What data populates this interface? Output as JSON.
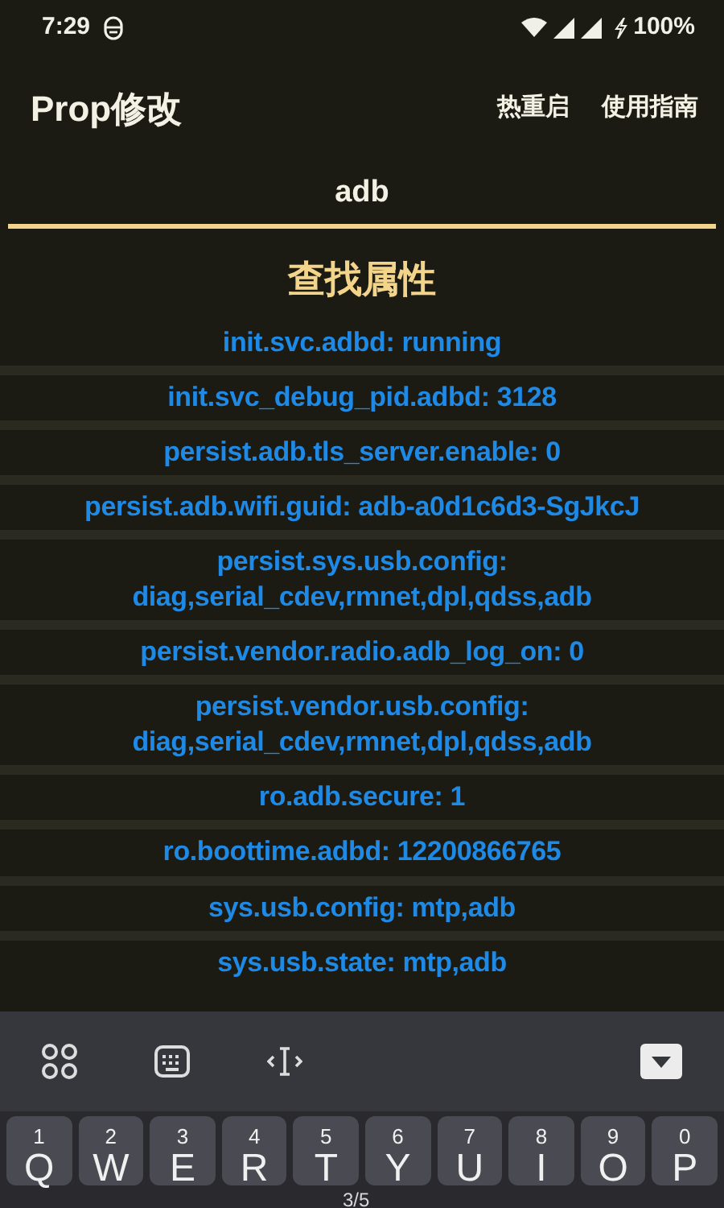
{
  "status_bar": {
    "time": "7:29",
    "battery": "100%"
  },
  "app_bar": {
    "title": "Prop修改",
    "actions": [
      "热重启",
      "使用指南"
    ]
  },
  "search": {
    "value": "adb"
  },
  "heading": "查找属性",
  "results": [
    "init.svc.adbd: running",
    "init.svc_debug_pid.adbd: 3128",
    "persist.adb.tls_server.enable: 0",
    "persist.adb.wifi.guid: adb-a0d1c6d3-SgJkcJ",
    "persist.sys.usb.config: diag,serial_cdev,rmnet,dpl,qdss,adb",
    "persist.vendor.radio.adb_log_on: 0",
    "persist.vendor.usb.config: diag,serial_cdev,rmnet,dpl,qdss,adb",
    "ro.adb.secure: 1",
    "ro.boottime.adbd: 12200866765",
    "sys.usb.config: mtp,adb",
    "sys.usb.state: mtp,adb"
  ],
  "keyboard": {
    "keys": [
      {
        "hint": "1",
        "label": "Q"
      },
      {
        "hint": "2",
        "label": "W"
      },
      {
        "hint": "3",
        "label": "E"
      },
      {
        "hint": "4",
        "label": "R"
      },
      {
        "hint": "5",
        "label": "T"
      },
      {
        "hint": "6",
        "label": "Y"
      },
      {
        "hint": "7",
        "label": "U"
      },
      {
        "hint": "8",
        "label": "I"
      },
      {
        "hint": "9",
        "label": "O"
      },
      {
        "hint": "0",
        "label": "P"
      }
    ],
    "page_indicator": "3/5"
  }
}
